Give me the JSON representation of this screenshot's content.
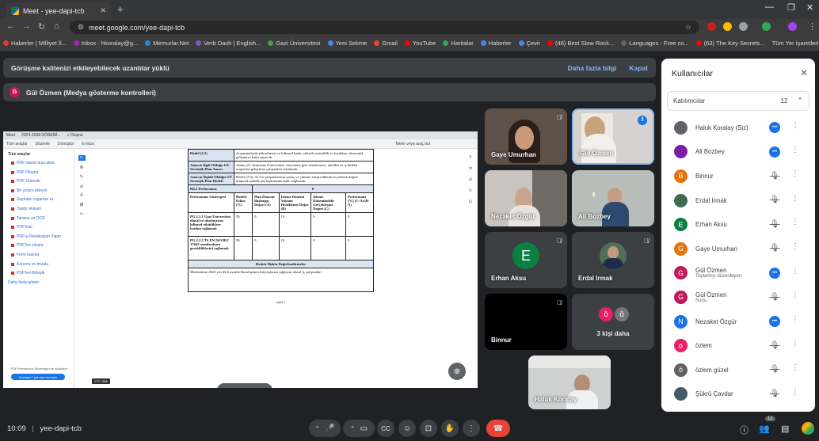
{
  "browser": {
    "tab_title": "Meet - yee-dapi-tcb",
    "url": "meet.google.com/yee-dapi-tcb",
    "bookmarks": [
      "Haberler | Milliyet İl...",
      "Inbox - hkoralay@g...",
      "Memurlar.Net",
      "Verb Dash | English...",
      "Gazi Üniversitesi",
      "Yeni Sekme",
      "Gmail",
      "YouTube",
      "Haritalar",
      "Haberler",
      "Çevir",
      "(46) Best Slow Rock...",
      "Languages - Free co...",
      "(63) The Key Secrets..."
    ],
    "all_bookmarks": "Tüm Yer İşaretleri"
  },
  "banner": {
    "warning": "Görüşme kalitenizi etkileyebilecek uzantılar yüklü",
    "more_info": "Daha fazla bilgi",
    "close": "Kapat"
  },
  "presenter": {
    "initial": "G",
    "label": "Gül Özmen (Medya gösterme kontrolleri)"
  },
  "shared_screen": {
    "tabs": [
      "Meet",
      "2024-2028 DÖNEMİ...",
      "+ Oluştur"
    ],
    "toolbar": [
      "Tüm araçlar",
      "Düzenle",
      "Dönüştür",
      "E-imza"
    ],
    "search": "Metin veya araç bul",
    "sidebar_title": "Tüm araçlar",
    "sidebar_items": [
      "PDF olarak dışa aktar",
      "PDF Oluştur",
      "PDF Düzenle",
      "Bir yorum ekleyin",
      "Sayfaları organize et",
      "Yazdır ekleyin",
      "Tarama ve OCR",
      "PDF'inizi",
      "PDF'yi Redaksiyon Yapın",
      "PDF'leri sıkıştır",
      "Form hazırla",
      "Koruma ve imzala",
      "PDF'leri Birleştir"
    ],
    "more_tools": "Daha fazla göster",
    "trial_note": "PDF formlarınızı düzenleyin ve doldurun",
    "trial_button": "Ücretsiz 7 gün için deneyin",
    "page_counter": "172 / 266",
    "doc": {
      "row1_label": "Hedef (2.2)",
      "row1_text": "Araştırmalarda yükseltmesi ve bilimsel katkı; yüksek verimlilik ve faydaları, ekonomik gelişmeye katkı sunacak.",
      "row2_label": "Amacın İlgili Olduğu GÜ Stratejik Plan Amacı",
      "row2_text": "Amaç (2): Araştırma Üniversitesi vizyonuna göre uluslararası, nitelikli ve iş birlikli araştırma-geliştirme çalışmaları yürütmek.",
      "row3_label": "Amacın İlişkili Olduğu GÜ Stratejik Plan Hedefi",
      "row3_text": "Hedef (2.3): Ar-Ge çalışmalarının sonuç ve çıktıları takip edilerek en yüksek değere ulaşacak şekilde paylaşılmasına katkı sağlamak.",
      "h_section": "H2.2 Performans",
      "h_value": "0",
      "headers": [
        "Performans Göstergesi",
        "Hedefe Etkisi (%)",
        "Plan Dönemi Başlangıç Değeri (A)",
        "İzleme Dönemi Yılsonu Hedeflenen Değer (B)",
        "İzleme Dönemindeki Gerçekleşme Değeri (C)",
        "Performans (%) (C-A)/(B-A)"
      ],
      "rows": [
        [
          "PG.2.2.1 Gazi Üniversitesi ulusal ve uluslararası bilimsel etkinliklere katılım sağlamak",
          "50",
          "0",
          "10",
          "0",
          "0"
        ],
        [
          "PG.2.2.2 TS EN ISO/IEC 17043 standardının gerekliliklerini sağlamak",
          "50",
          "0",
          "10",
          "0",
          "0"
        ]
      ],
      "evaluation": "Hedefe İlişkin Değerlendirmeler",
      "evaluation_text": "Merkezimiz 2024 yılı ilk 6 ayında Kuruluşların ihtiyaçlarına sağlayan ulusal iş çalışmaları",
      "page_num": "sayfa 1"
    }
  },
  "tiles": [
    {
      "name": "Gaye Umurhan",
      "kind": "video"
    },
    {
      "name": "Gül Özmen",
      "kind": "video"
    },
    {
      "name": "Nezaket Özgür",
      "kind": "video"
    },
    {
      "name": "Ali Bozbey",
      "kind": "video"
    },
    {
      "name": "Erhan Aksu",
      "kind": "avatar",
      "initial": "E",
      "color": "#0b8043"
    },
    {
      "name": "Erdal Irmak",
      "kind": "avatar-photo"
    },
    {
      "name": "Binnur",
      "kind": "dark"
    },
    {
      "name": "3 kişi daha",
      "kind": "more",
      "initials": [
        "ö",
        "ö"
      ]
    },
    {
      "name": "Haluk Koralay",
      "kind": "self"
    }
  ],
  "bottom": {
    "time": "10:09",
    "separator": "|",
    "meeting_code": "yee-dapi-tcb",
    "participant_badge": "12"
  },
  "panel": {
    "title": "Kullanıcılar",
    "section": "Katılımcılar",
    "count": "12",
    "people": [
      {
        "name": "Haluk Koralay (Siz)",
        "sub": "",
        "state": "speaking",
        "color": "#5f6368",
        "initial": ""
      },
      {
        "name": "Ali Bozbey",
        "sub": "",
        "state": "speaking",
        "color": "#7b1fa2",
        "initial": ""
      },
      {
        "name": "Binnur",
        "sub": "",
        "state": "muted",
        "color": "#e8710a",
        "initial": "B"
      },
      {
        "name": "Erdal Irmak",
        "sub": "",
        "state": "muted",
        "color": "#3f6c51",
        "initial": ""
      },
      {
        "name": "Erhan Aksu",
        "sub": "",
        "state": "muted",
        "color": "#0b8043",
        "initial": "E"
      },
      {
        "name": "Gaye Umurhan",
        "sub": "",
        "state": "muted",
        "color": "#e8710a",
        "initial": "G"
      },
      {
        "name": "Gül Özmen",
        "sub": "Toplantıyı düzenleyen",
        "state": "speaking",
        "color": "#c2185b",
        "initial": "G"
      },
      {
        "name": "Gül Özmen",
        "sub": "Sunu",
        "state": "muted-present",
        "color": "#c2185b",
        "initial": "G"
      },
      {
        "name": "Nezaket Özgür",
        "sub": "",
        "state": "speaking",
        "color": "#1a73e8",
        "initial": "N"
      },
      {
        "name": "özlem",
        "sub": "",
        "state": "muted",
        "color": "#e91e63",
        "initial": "ö"
      },
      {
        "name": "özlem güzel",
        "sub": "",
        "state": "muted",
        "color": "#616161",
        "initial": "ö"
      },
      {
        "name": "Şükrü Çavdar",
        "sub": "",
        "state": "muted",
        "color": "#455a64",
        "initial": ""
      }
    ]
  },
  "colors": {
    "meet_bg": "#202124",
    "hangup": "#ea4335",
    "accent": "#8ab4f8",
    "speaking": "#1a73e8"
  }
}
